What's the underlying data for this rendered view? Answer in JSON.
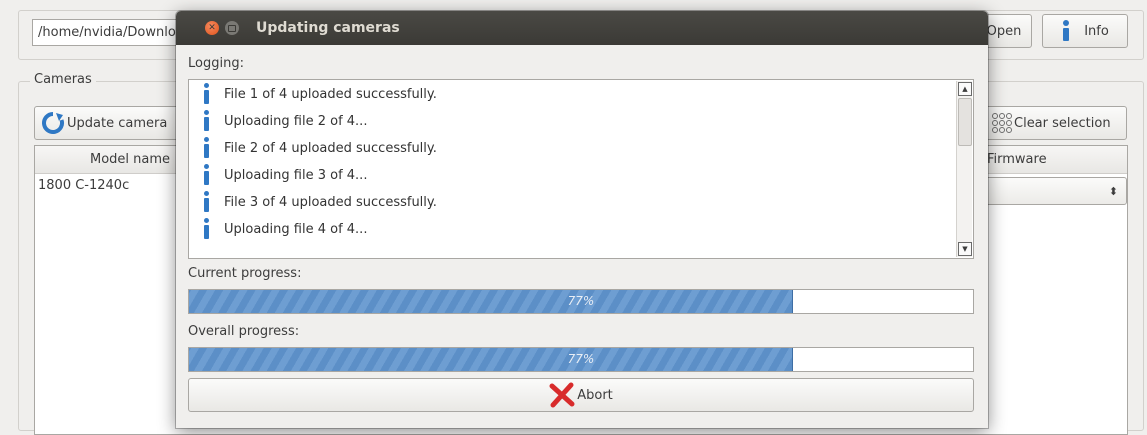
{
  "main": {
    "path": "/home/nvidia/Downloads",
    "open_label": "Open",
    "info_label": "Info",
    "cameras_group_label": "Cameras",
    "update_label": "Update camera",
    "clear_label": "Clear selection",
    "columns": {
      "model": "Model name",
      "firmware": "Firmware"
    },
    "rows": [
      {
        "model": "1800 C-1240c"
      }
    ],
    "select_arrows": "⬍"
  },
  "dialog": {
    "title": "Updating cameras",
    "logging_label": "Logging:",
    "log": [
      "File 1 of 4 uploaded successfully.",
      "Uploading file 2 of 4...",
      "File 2 of 4 uploaded successfully.",
      "Uploading file 3 of 4...",
      "File 3 of 4 uploaded successfully.",
      "Uploading file 4 of 4..."
    ],
    "current_label": "Current progress:",
    "current_value": 0.77,
    "current_text": "77%",
    "overall_label": "Overall progress:",
    "overall_value": 0.77,
    "overall_text": "77%",
    "abort_label": "Abort"
  },
  "icons": {
    "info": "info-icon",
    "refresh": "refresh-icon",
    "clear": "grid-icon",
    "abort": "x-icon"
  },
  "colors": {
    "progress_fill": "#5c8fc7",
    "titlebar": "#3b3a36",
    "close": "#e0531b",
    "abort_x": "#d82b2b"
  }
}
